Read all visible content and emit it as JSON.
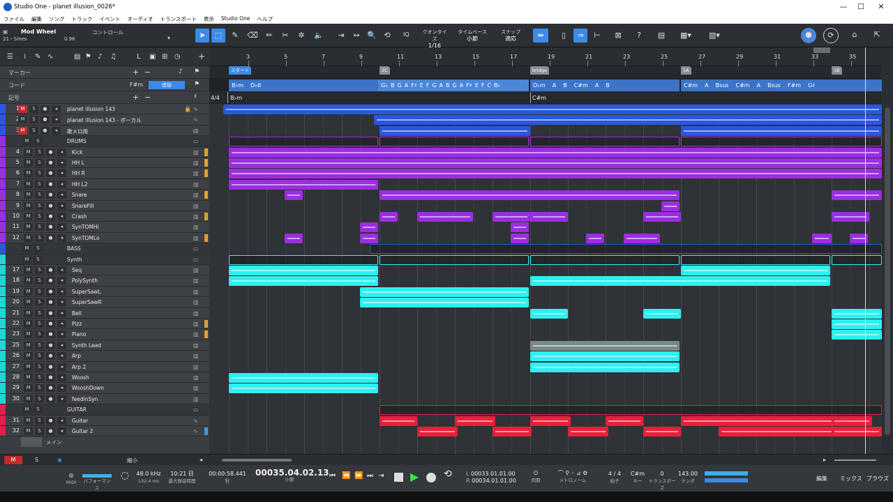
{
  "window": {
    "title": "Studio One - planet illusion_0026*",
    "controls": [
      "—",
      "☐",
      "✕"
    ]
  },
  "menu": [
    "ファイル",
    "編集",
    "ソング",
    "トラック",
    "イベント",
    "オーディオ",
    "トランスポート",
    "表示",
    "Studio One",
    "ヘルプ"
  ],
  "toolbar": {
    "instrument_name": "Mod Wheel",
    "instrument_preset": "21 - Sines",
    "control_label": "コントロール",
    "control_value": "0.96",
    "quantize_label": "クオンタイズ",
    "quantize_value": "1/16",
    "timebase_label": "タイムベース",
    "timebase_value": "小節",
    "snap_label": "スナップ",
    "snap_value": "適応",
    "iq_label": "IQ"
  },
  "global_tracks": {
    "marker": "マーカー",
    "chord": "コード",
    "chord_key": "F#m",
    "chord_follow": "追従",
    "signature": "記号"
  },
  "ruler": {
    "bars": [
      "3",
      "5",
      "7",
      "9",
      "11",
      "13",
      "15",
      "17",
      "19",
      "21",
      "23",
      "25",
      "27",
      "29",
      "31",
      "33",
      "35"
    ]
  },
  "markers": [
    "スタート",
    "2C",
    "bridge",
    "1A",
    "1B"
  ],
  "time_signature": {
    "sig": "4/4",
    "key_start": "B♭m",
    "key_bridge": "C#m"
  },
  "chord_blocks": [
    {
      "labels": [
        "B♭m",
        "D♭6"
      ]
    },
    {
      "labels": [
        "G♭",
        "B",
        "G",
        "A",
        "F♯",
        "E",
        "F",
        "G",
        "A",
        "B",
        "G",
        "A",
        "F♯",
        "E",
        "F",
        "C",
        "B♭"
      ]
    },
    {
      "labels": [
        "D♭m",
        "A",
        "B",
        "C#m",
        "A",
        "B"
      ]
    },
    {
      "labels": [
        "C#m",
        "A",
        "Bsus",
        "C#m",
        "A",
        "Bsus",
        "F#m",
        "G♯"
      ]
    }
  ],
  "tracks": [
    {
      "num": "1",
      "name": "planet illusion 143",
      "color": "#2a56e0",
      "mute_on": true,
      "icon": "wave",
      "lock": true
    },
    {
      "num": "2",
      "name": "planet illusion 143 - ボーカル",
      "color": "#2a56e0",
      "mute_on": false,
      "icon": "wave"
    },
    {
      "num": "3",
      "name": "歌メロ用",
      "color": "#2a56e0",
      "mute_on": true,
      "icon": "piano"
    },
    {
      "num": "",
      "name": "DRUMS",
      "color": "#9b2ee0",
      "folder": true,
      "icon": "folder"
    },
    {
      "num": "4",
      "name": "Kick",
      "color": "#9b2ee0",
      "icon": "piano",
      "side": "#e0a030"
    },
    {
      "num": "5",
      "name": "HH L",
      "color": "#9b2ee0",
      "icon": "piano",
      "side": "#e0a030"
    },
    {
      "num": "6",
      "name": "HH R",
      "color": "#9b2ee0",
      "icon": "piano",
      "side": "#e0a030"
    },
    {
      "num": "7",
      "name": "HH L2",
      "color": "#9b2ee0",
      "icon": "piano"
    },
    {
      "num": "8",
      "name": "Snare",
      "color": "#9b2ee0",
      "icon": "piano",
      "side": "#e0a030"
    },
    {
      "num": "9",
      "name": "SnareFill",
      "color": "#9b2ee0",
      "icon": "piano"
    },
    {
      "num": "10",
      "name": "Crash",
      "color": "#9b2ee0",
      "icon": "piano",
      "side": "#e0a030"
    },
    {
      "num": "11",
      "name": "SynTOMHi",
      "color": "#9b2ee0",
      "icon": "piano"
    },
    {
      "num": "12",
      "name": "SynTOMLo",
      "color": "#9b2ee0",
      "icon": "piano",
      "side": "#e0a030"
    },
    {
      "num": "",
      "name": "BASS",
      "color": "#2a56e0",
      "folder": true,
      "icon": "folder"
    },
    {
      "num": "",
      "name": "Synth",
      "color": "#1ed6d6",
      "folder": true,
      "icon": "folder"
    },
    {
      "num": "17",
      "name": "Seq",
      "color": "#1ed6d6",
      "icon": "piano"
    },
    {
      "num": "18",
      "name": "PolySynth",
      "color": "#1ed6d6",
      "icon": "piano"
    },
    {
      "num": "19",
      "name": "SuperSawL",
      "color": "#1ed6d6",
      "icon": "piano"
    },
    {
      "num": "20",
      "name": "SuperSawR",
      "color": "#1ed6d6",
      "icon": "piano"
    },
    {
      "num": "21",
      "name": "Bell",
      "color": "#1ed6d6",
      "icon": "piano"
    },
    {
      "num": "22",
      "name": "Pizz",
      "color": "#1ed6d6",
      "icon": "piano",
      "side": "#e0a030"
    },
    {
      "num": "23",
      "name": "Piano",
      "color": "#1ed6d6",
      "icon": "piano",
      "side": "#e0a030"
    },
    {
      "num": "25",
      "name": "Synth Lead",
      "color": "#1ed6d6",
      "icon": "piano"
    },
    {
      "num": "26",
      "name": "Arp",
      "color": "#1ed6d6",
      "icon": "piano"
    },
    {
      "num": "27",
      "name": "Arp 2",
      "color": "#1ed6d6",
      "icon": "piano"
    },
    {
      "num": "28",
      "name": "Woosh",
      "color": "#1ed6d6",
      "icon": "piano"
    },
    {
      "num": "29",
      "name": "WooshDown",
      "color": "#1ed6d6",
      "icon": "piano"
    },
    {
      "num": "30",
      "name": "feedinSyn",
      "color": "#1ed6d6",
      "icon": "piano"
    },
    {
      "num": "",
      "name": "GUITAR",
      "color": "#e0204a",
      "folder": true,
      "icon": "folder"
    },
    {
      "num": "31",
      "name": "Guitar",
      "color": "#e0204a",
      "icon": "wave"
    },
    {
      "num": "32",
      "name": "Guitar 2",
      "color": "#e0204a",
      "icon": "wave",
      "side": "#3a9be0"
    }
  ],
  "footer_left": {
    "mute": "M",
    "solo": "S",
    "zoom_label": "縮小",
    "track_label": "メイン"
  },
  "transport": {
    "midi": "MIDI",
    "performance": "パフォーマンス",
    "sample_rate": "48.0 kHz",
    "latency": "132.4 ms",
    "record_time": "10:21 日",
    "record_label": "最大録音時間",
    "seconds": "00:00:58.441",
    "seconds_label": "秒",
    "position": "00035.04.02.13",
    "position_label": "小節",
    "loop_l": "00033.01.01.00",
    "loop_r": "00034.01.01.00",
    "sync_label": "同期",
    "metronome_label": "メトロノーム",
    "time_sig": "4 / 4",
    "time_sig_label": "拍子",
    "key": "C#m",
    "key_label": "キー",
    "transpose": "0",
    "transpose_label": "トランスポーズ",
    "tempo": "143.00",
    "tempo_label": "テンポ"
  },
  "views": {
    "edit": "編集",
    "mix": "ミックス",
    "browse": "ブラウズ"
  }
}
